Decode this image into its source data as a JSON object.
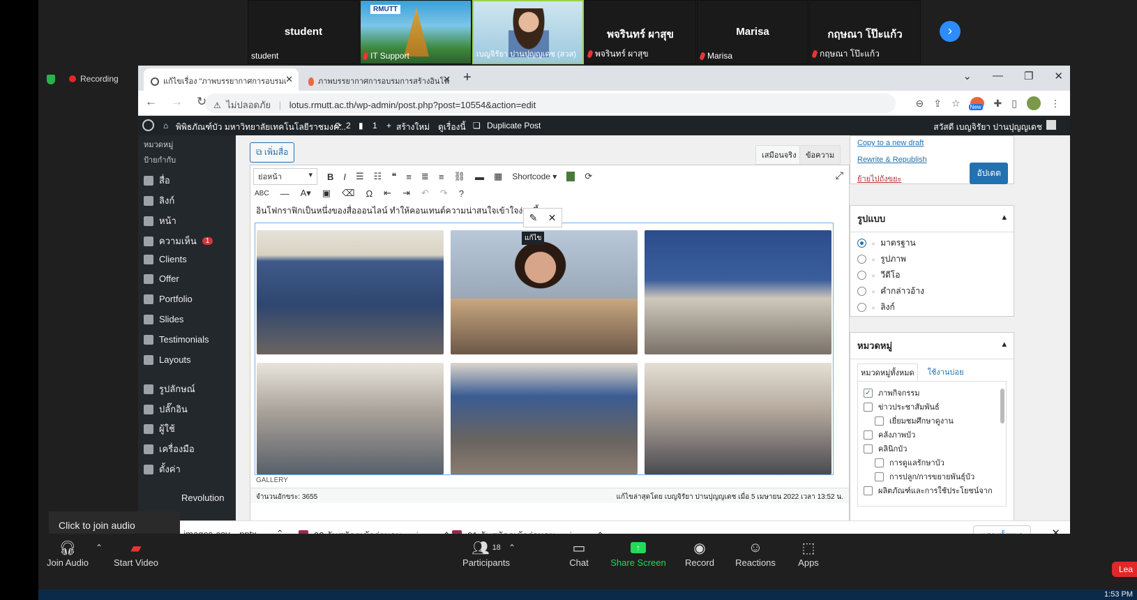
{
  "gallery": {
    "tiles": [
      {
        "name": "student",
        "label": "student",
        "muted": false
      },
      {
        "name": "",
        "label": "IT Support",
        "muted": true
      },
      {
        "name": "",
        "label": "เบญจิรัยา ปานปุญญเดช (สวส)",
        "muted": false
      },
      {
        "name": "พจรินทร์ ผาสุข",
        "label": "พจรินทร์ ผาสุข",
        "muted": true
      },
      {
        "name": "Marisa",
        "label": "Marisa",
        "muted": true
      },
      {
        "name": "กฤษณา โป๊ะแก้ว",
        "label": "กฤษณา โป๊ะแก้ว",
        "muted": true
      }
    ],
    "tile2_logo": "RMUTT"
  },
  "recording": "Recording",
  "browser": {
    "tabs": [
      "แก้ไขเรื่อง \"ภาพบรรยากาศการอบรมเ",
      "ภาพบรรยากาศการอบรมการสร้างอินโฟ"
    ],
    "security_label": "ไม่ปลอดภัย",
    "url": "lotus.rmutt.ac.th/wp-admin/post.php?post=10554&action=edit",
    "new_badge": "New"
  },
  "wpbar": {
    "site": "พิพิธภัณฑ์บัว มหาวิทยาลัยเทคโนโลยีราชมงค...",
    "updates": "2",
    "comments": "1",
    "new": "สร้างใหม่",
    "view": "ดูเรื่องนี้",
    "duplicate": "Duplicate Post",
    "greeting": "สวัสดี เบญจิรัยา ปานปุญญเดช"
  },
  "sidebar": {
    "top": [
      "หมวดหมู่",
      "ป้ายกำกับ"
    ],
    "items": [
      {
        "label": "สื่อ",
        "icon": "media-icon"
      },
      {
        "label": "ลิงก์",
        "icon": "link-icon"
      },
      {
        "label": "หน้า",
        "icon": "page-icon"
      },
      {
        "label": "ความเห็น",
        "icon": "comment-icon",
        "badge": "1"
      },
      {
        "label": "Clients",
        "icon": "clients-icon"
      },
      {
        "label": "Offer",
        "icon": "tag-icon"
      },
      {
        "label": "Portfolio",
        "icon": "portfolio-icon"
      },
      {
        "label": "Slides",
        "icon": "slides-icon"
      },
      {
        "label": "Testimonials",
        "icon": "quote-icon"
      },
      {
        "label": "Layouts",
        "icon": "layouts-icon"
      },
      {
        "label": "รูปลักษณ์",
        "icon": "appearance-icon"
      },
      {
        "label": "ปลั๊กอิน",
        "icon": "plugin-icon"
      },
      {
        "label": "ผู้ใช้",
        "icon": "user-icon"
      },
      {
        "label": "เครื่องมือ",
        "icon": "tools-icon"
      },
      {
        "label": "ตั้งค่า",
        "icon": "settings-icon"
      }
    ],
    "revolution": "Revolution",
    "tooltip": "Click to join audio"
  },
  "editor": {
    "add_media": "เพิ่มสื่อ",
    "tab_visual": "เสมือนจริง",
    "tab_text": "ข้อความ",
    "format": "ย่อหน้า",
    "shortcode": "Shortcode",
    "intro_text": "อินโฟกราฟิกเป็นหนึ่งของสื่อออนไลน์ ทำให้คอนเทนต์ความน่าสนใจเข้าใจง่ายขึ้น",
    "edit_tooltip": "แก้ไข",
    "gallery_label": "GALLERY",
    "word_count": "จำนวนอักขระ: 3655",
    "last_edited": "แก้ไขล่าสุดโดย เบญจิรัยา ปานปุญญเดช เมื่อ 5 เมษายน 2022 เวลา 13:52 น."
  },
  "publish": {
    "copy_draft": "Copy to a new draft",
    "rewrite": "Rewrite & Republish",
    "trash": "ย้ายไปถังขยะ",
    "update": "อัปเดต"
  },
  "format_box": {
    "title": "รูปแบบ",
    "options": [
      "มาตรฐาน",
      "รูปภาพ",
      "วีดีโอ",
      "คำกล่าวอ้าง",
      "ลิงก์"
    ]
  },
  "category_box": {
    "title": "หมวดหมู่",
    "tab_all": "หมวดหมู่ทั้งหมด",
    "tab_popular": "ใช้งานบ่อย",
    "items": [
      {
        "label": "ภาพกิจกรรม",
        "checked": true,
        "indent": false
      },
      {
        "label": "ข่าวประชาสัมพันธ์",
        "checked": false,
        "indent": false
      },
      {
        "label": "เยี่ยมชมศึกษาดูงาน",
        "checked": false,
        "indent": true
      },
      {
        "label": "คลังภาพบัว",
        "checked": false,
        "indent": false
      },
      {
        "label": "คลินิกบัว",
        "checked": false,
        "indent": false
      },
      {
        "label": "การดูแลรักษาบัว",
        "checked": false,
        "indent": true
      },
      {
        "label": "การปลูก/การขยายพันธุ์บัว",
        "checked": false,
        "indent": true
      },
      {
        "label": "ผลิตภัณฑ์และการใช้ประโยชน์จาก",
        "checked": false,
        "indent": false
      }
    ]
  },
  "downloads": {
    "files": [
      "2022-images-cov....pptx",
      "03-รับสมัครเข้าร่วมอบ....zip",
      "01-รับสมัครเข้าร่วมอบ....zip"
    ],
    "show_all": "แสดงทั้งหมด"
  },
  "zoom": {
    "join_audio": "Join Audio",
    "start_video": "Start Video",
    "participants": "Participants",
    "participant_count": "18",
    "chat": "Chat",
    "share": "Share Screen",
    "record": "Record",
    "reactions": "Reactions",
    "apps": "Apps",
    "leave": "Lea"
  },
  "clock": "1:53 PM",
  "colors": {
    "share_green": "#23d959",
    "wp_blue": "#2271b1",
    "wp_dark": "#1d2327",
    "recording_red": "#e02828"
  }
}
